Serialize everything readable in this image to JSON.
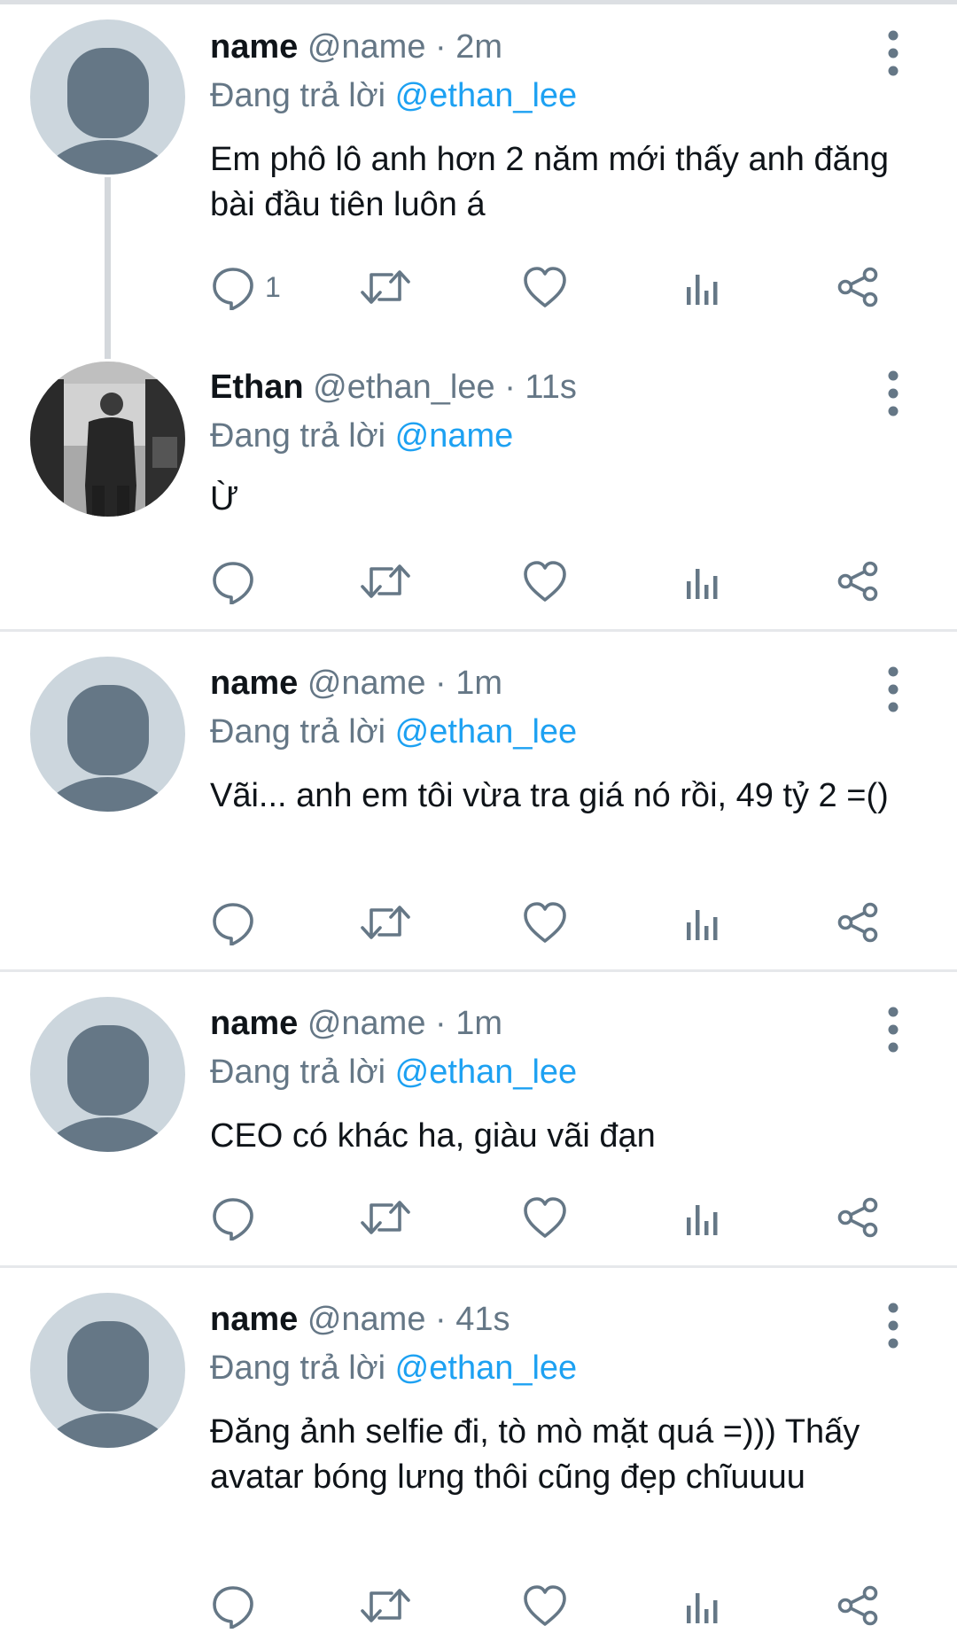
{
  "tweets": [
    {
      "name": "name",
      "handle": "@name",
      "time": "· 2m",
      "reply_prefix": "Đang trả lời",
      "reply_to": "@ethan_lee",
      "text": "Em phô lô anh hơn 2 năm mới thấy anh đăng bài đầu tiên luôn á",
      "reply_count": "1",
      "avatar": "default-avatar"
    },
    {
      "name": "Ethan",
      "handle": "@ethan_lee",
      "time": "· 11s",
      "reply_prefix": "Đang trả lời",
      "reply_to": "@name",
      "text": "Ừ",
      "reply_count": "",
      "avatar": "photo-avatar"
    },
    {
      "name": "name",
      "handle": "@name",
      "time": "· 1m",
      "reply_prefix": "Đang trả lời",
      "reply_to": "@ethan_lee",
      "text": "Vãi... anh em tôi vừa tra giá nó rồi, 49 tỷ 2 =()",
      "reply_count": "",
      "avatar": "default-avatar"
    },
    {
      "name": "name",
      "handle": "@name",
      "time": "· 1m",
      "reply_prefix": "Đang trả lời",
      "reply_to": "@ethan_lee",
      "text": "CEO có khác ha, giàu vãi đạn",
      "reply_count": "",
      "avatar": "default-avatar"
    },
    {
      "name": "name",
      "handle": "@name",
      "time": "· 41s",
      "reply_prefix": "Đang trả lời",
      "reply_to": "@ethan_lee",
      "text": "Đăng ảnh selfie đi, tò mò mặt quá =))) Thấy avatar bóng lưng thôi cũng đẹp chĩuuuu",
      "reply_count": "",
      "avatar": "default-avatar"
    }
  ],
  "icons": {
    "reply": "reply-icon",
    "retweet": "retweet-icon",
    "like": "like-icon",
    "stats": "stats-icon",
    "share": "share-icon",
    "more": "more-icon"
  },
  "colors": {
    "text": "#0f1419",
    "secondary": "#657786",
    "mention": "#1da1f2",
    "avatar_bg": "#ccd6dd",
    "avatar_fg": "#657786",
    "separator": "#e6e8eb"
  }
}
